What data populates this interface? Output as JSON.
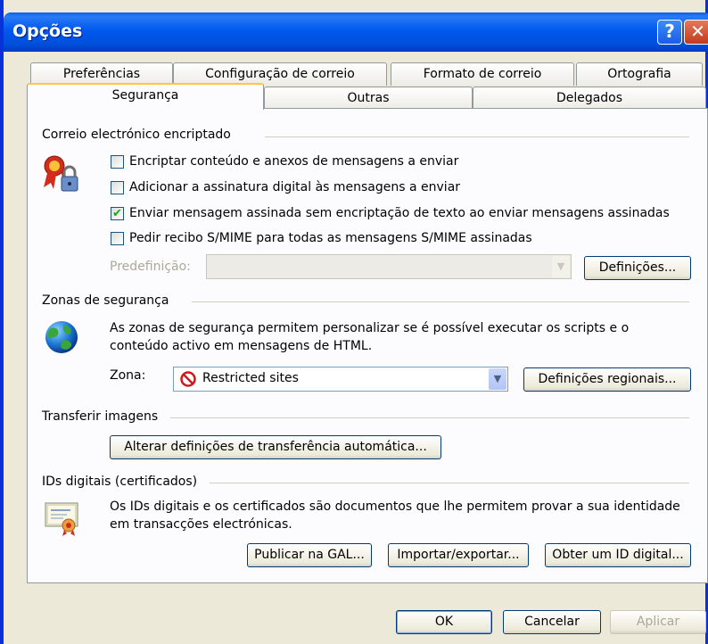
{
  "window": {
    "title": "Opções"
  },
  "tabs_back": [
    "Preferências",
    "Configuração de correio",
    "Formato de correio",
    "Ortografia"
  ],
  "tabs_front": [
    "Segurança",
    "Outras",
    "Delegados"
  ],
  "encrypted_mail": {
    "title": "Correio electrónico encriptado",
    "options": [
      {
        "label": "Encriptar conteúdo e anexos de mensagens a enviar",
        "checked": false
      },
      {
        "label": "Adicionar a assinatura digital às mensagens a enviar",
        "checked": false
      },
      {
        "label": "Enviar mensagem assinada sem encriptação de texto ao enviar mensagens assinadas",
        "checked": true
      },
      {
        "label": "Pedir recibo S/MIME para todas as mensagens S/MIME assinadas",
        "checked": false
      }
    ],
    "default_label": "Predefinição:",
    "default_value": "",
    "settings_button": "Definições..."
  },
  "security_zones": {
    "title": "Zonas de segurança",
    "description": "As zonas de segurança permitem personalizar se é possível executar os scripts e o conteúdo activo em mensagens de HTML.",
    "zone_label": "Zona:",
    "zone_value": "Restricted sites",
    "zone_settings_button": "Definições regionais..."
  },
  "download_pictures": {
    "title": "Transferir imagens",
    "button": "Alterar definições de transferência automática..."
  },
  "digital_ids": {
    "title": "IDs digitais (certificados)",
    "description": "Os IDs digitais e os certificados são documentos que lhe permitem provar a sua identidade em transacções electrónicas.",
    "buttons": [
      "Publicar na GAL...",
      "Importar/exportar...",
      "Obter um ID digital..."
    ]
  },
  "footer": {
    "ok": "OK",
    "cancel": "Cancelar",
    "apply": "Aplicar"
  },
  "colors": {
    "titlebar": "#0058ee",
    "dialog_bg": "#ece9d8",
    "panel_bg": "#fcfcfe",
    "active_tab_accent": "#ffc83c"
  }
}
